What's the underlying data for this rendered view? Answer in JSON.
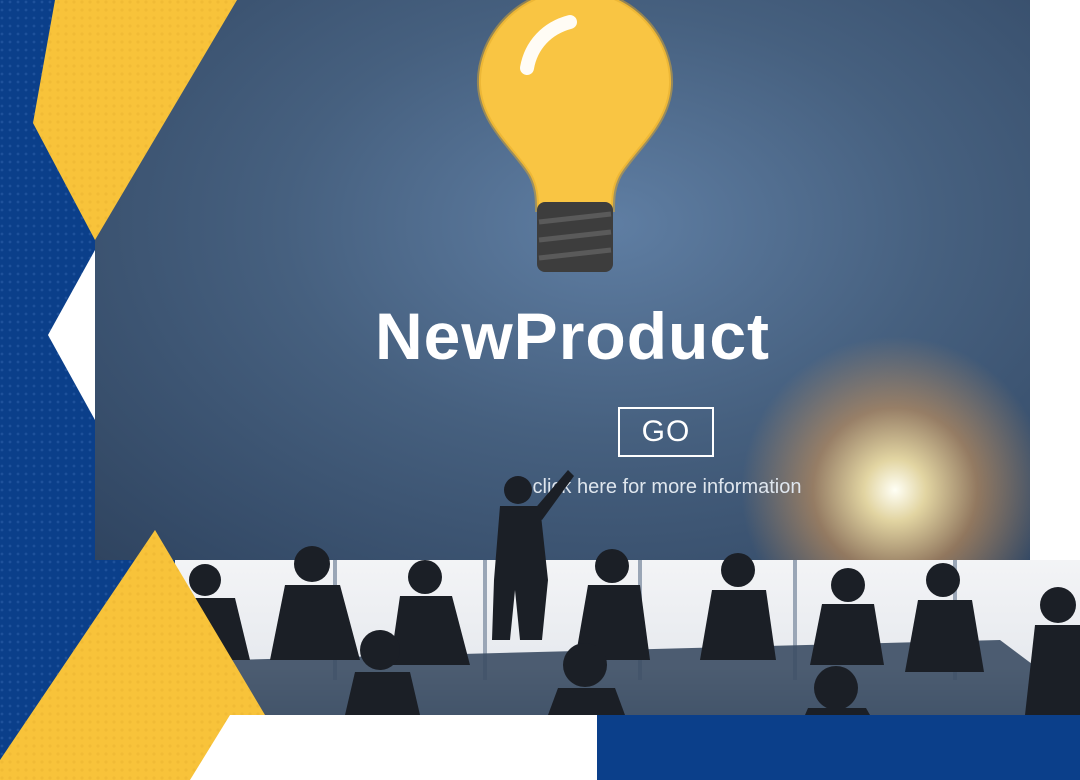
{
  "headline": "NewProduct",
  "go_button": "GO",
  "subtext": "click here for more information",
  "colors": {
    "brand_blue": "#0b3f8a",
    "accent_yellow": "#f8c33a",
    "screen_blue": "#46607f",
    "bulb_yellow": "#f9c543",
    "bulb_base": "#3d3d3d"
  },
  "icons": [
    "light-bulb-icon"
  ]
}
